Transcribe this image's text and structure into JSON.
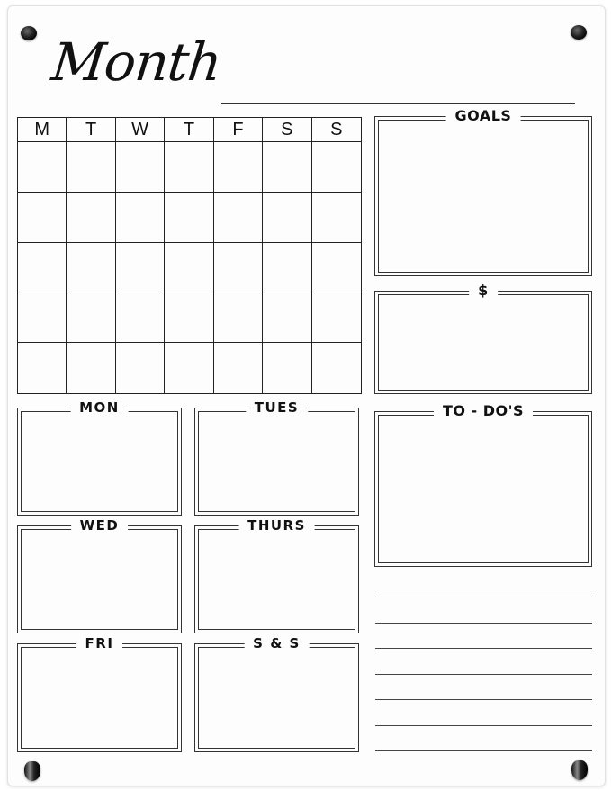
{
  "title": "Month",
  "weekdays": [
    "M",
    "T",
    "W",
    "T",
    "F",
    "S",
    "S"
  ],
  "sections": {
    "goals": "GOALS",
    "money": "$",
    "todos": "TO - DO'S",
    "mon": "MON",
    "tues": "TUES",
    "wed": "WED",
    "thurs": "THURS",
    "fri": "FRI",
    "weekend": "S & S"
  }
}
